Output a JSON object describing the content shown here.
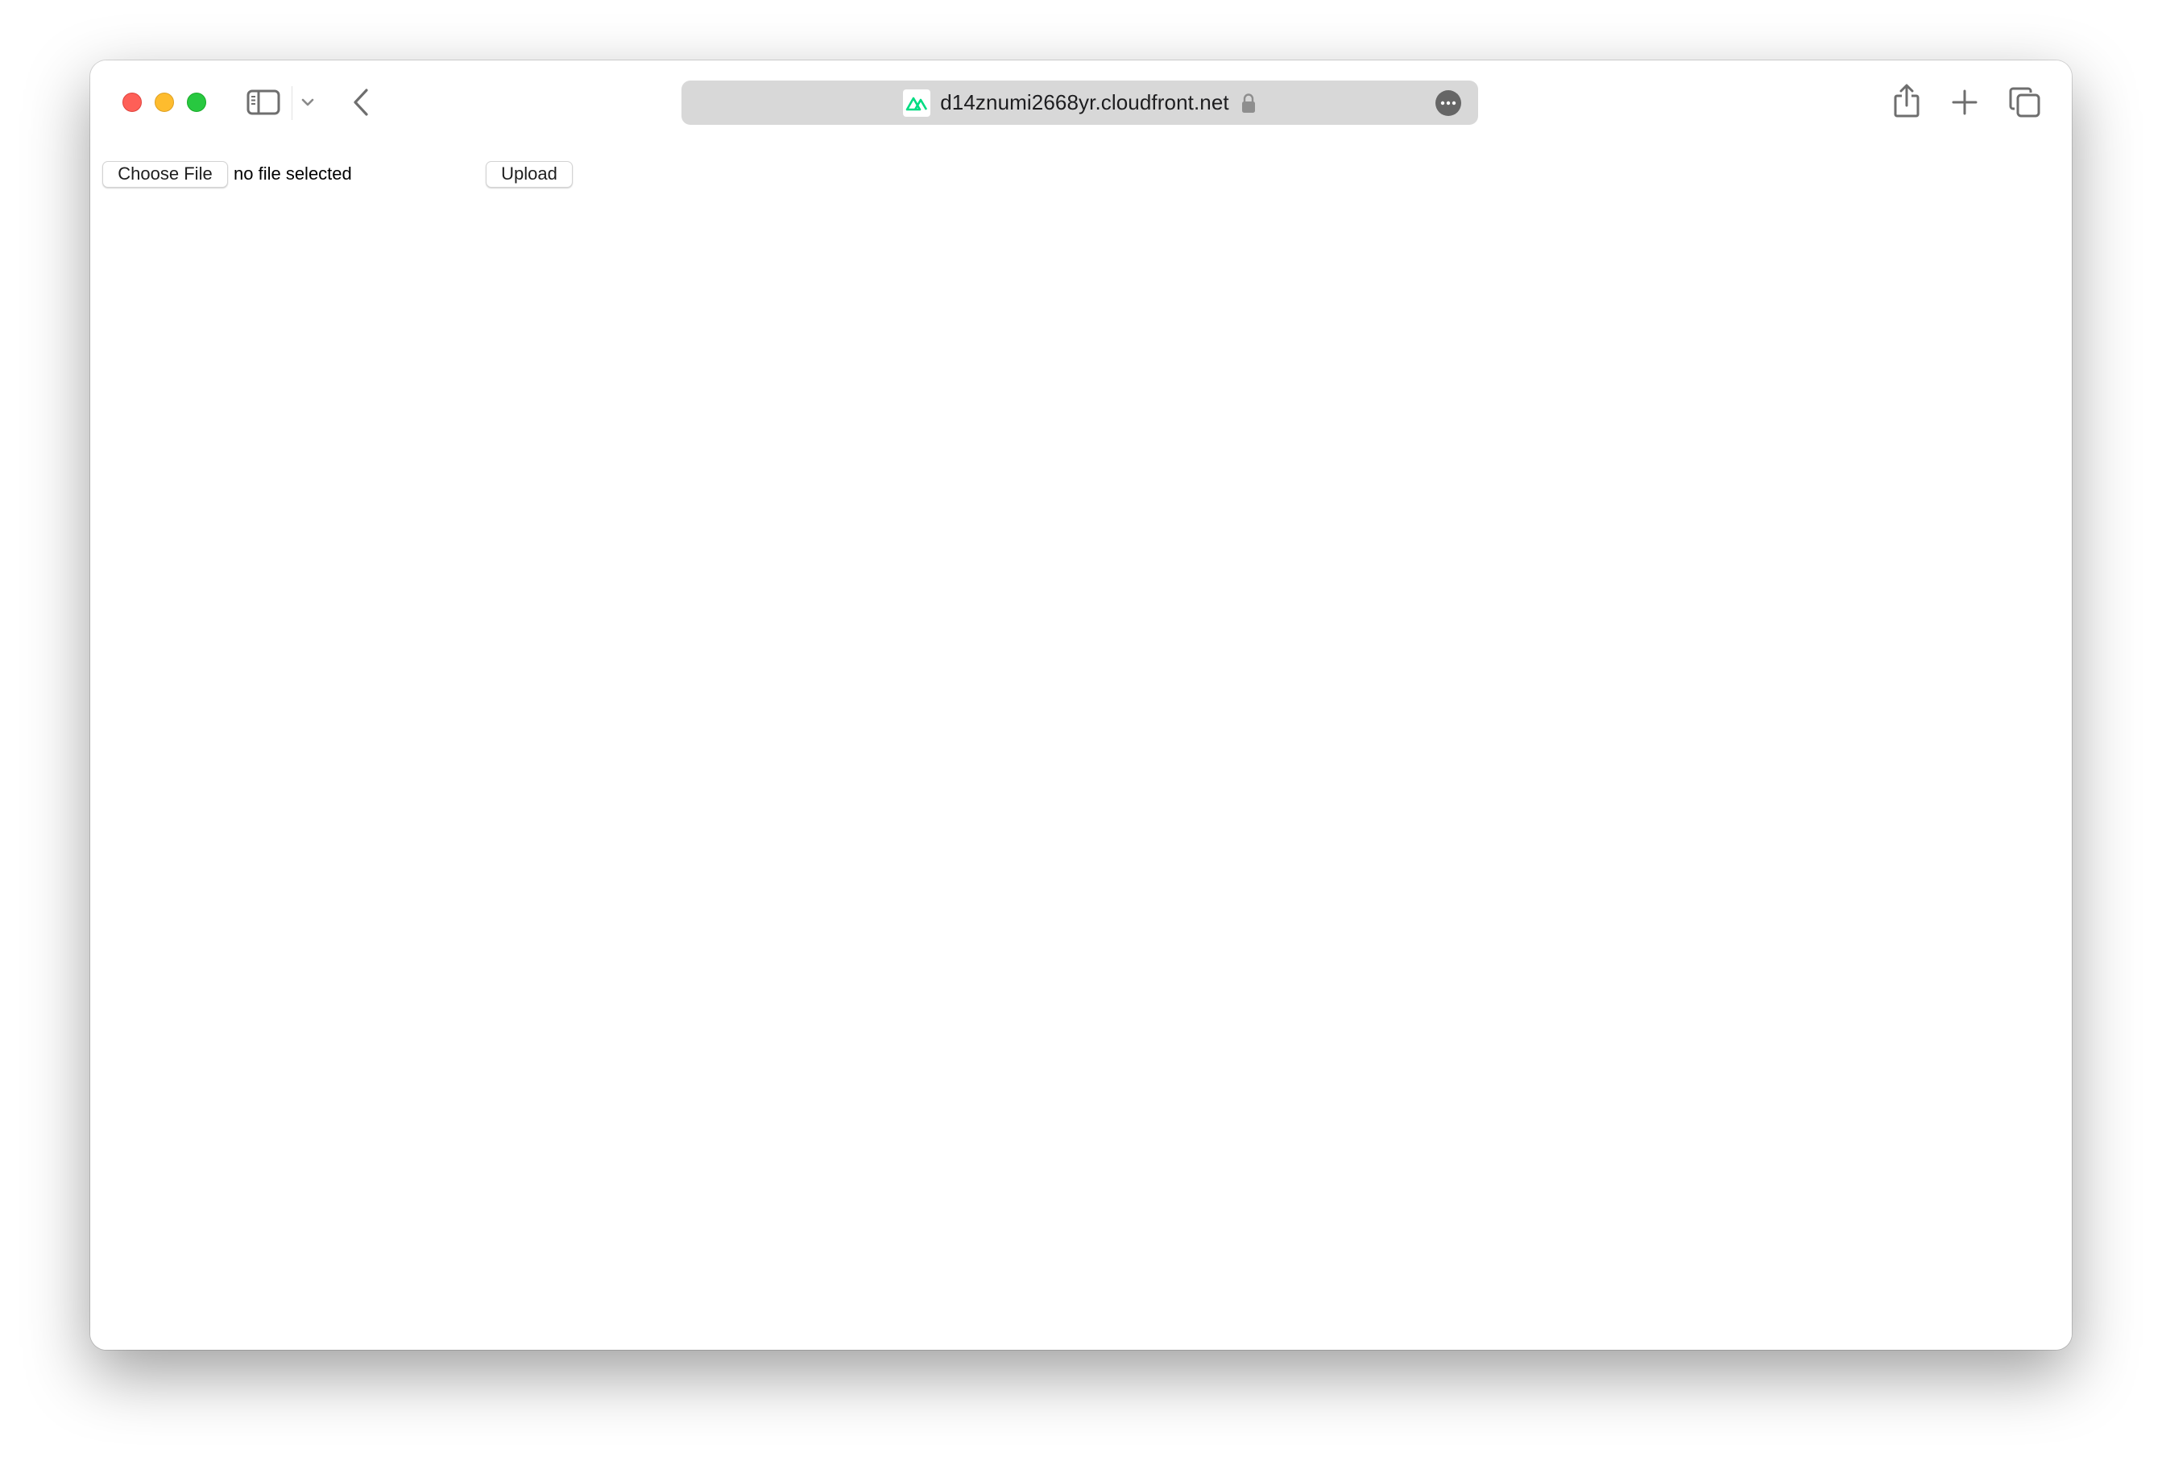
{
  "browser": {
    "window_controls": {
      "close": "close-window",
      "minimize": "minimize-window",
      "zoom": "zoom-window"
    },
    "toolbar": {
      "sidebar_icon": "sidebar-icon",
      "tab_overview_icon": "chevron-down-icon",
      "back_icon": "chevron-left-icon",
      "share_icon": "share-icon",
      "new_tab_icon": "plus-icon",
      "tab_overview_grid_icon": "tabs-icon"
    },
    "address_bar": {
      "favicon": "nuxt-logo-icon",
      "url": "d14znumi2668yr.cloudfront.net",
      "secure": true,
      "lock_icon": "lock-icon",
      "more_icon": "ellipsis-icon"
    },
    "colors": {
      "favicon_green": "#00dc82",
      "address_bar_bg": "#d8d8d8",
      "traffic_red": "#fe5f57",
      "traffic_yellow": "#febc2e",
      "traffic_green": "#28c840"
    }
  },
  "page": {
    "file_input": {
      "button_label": "Choose File",
      "status_text": "no file selected"
    },
    "upload_button_label": "Upload"
  }
}
